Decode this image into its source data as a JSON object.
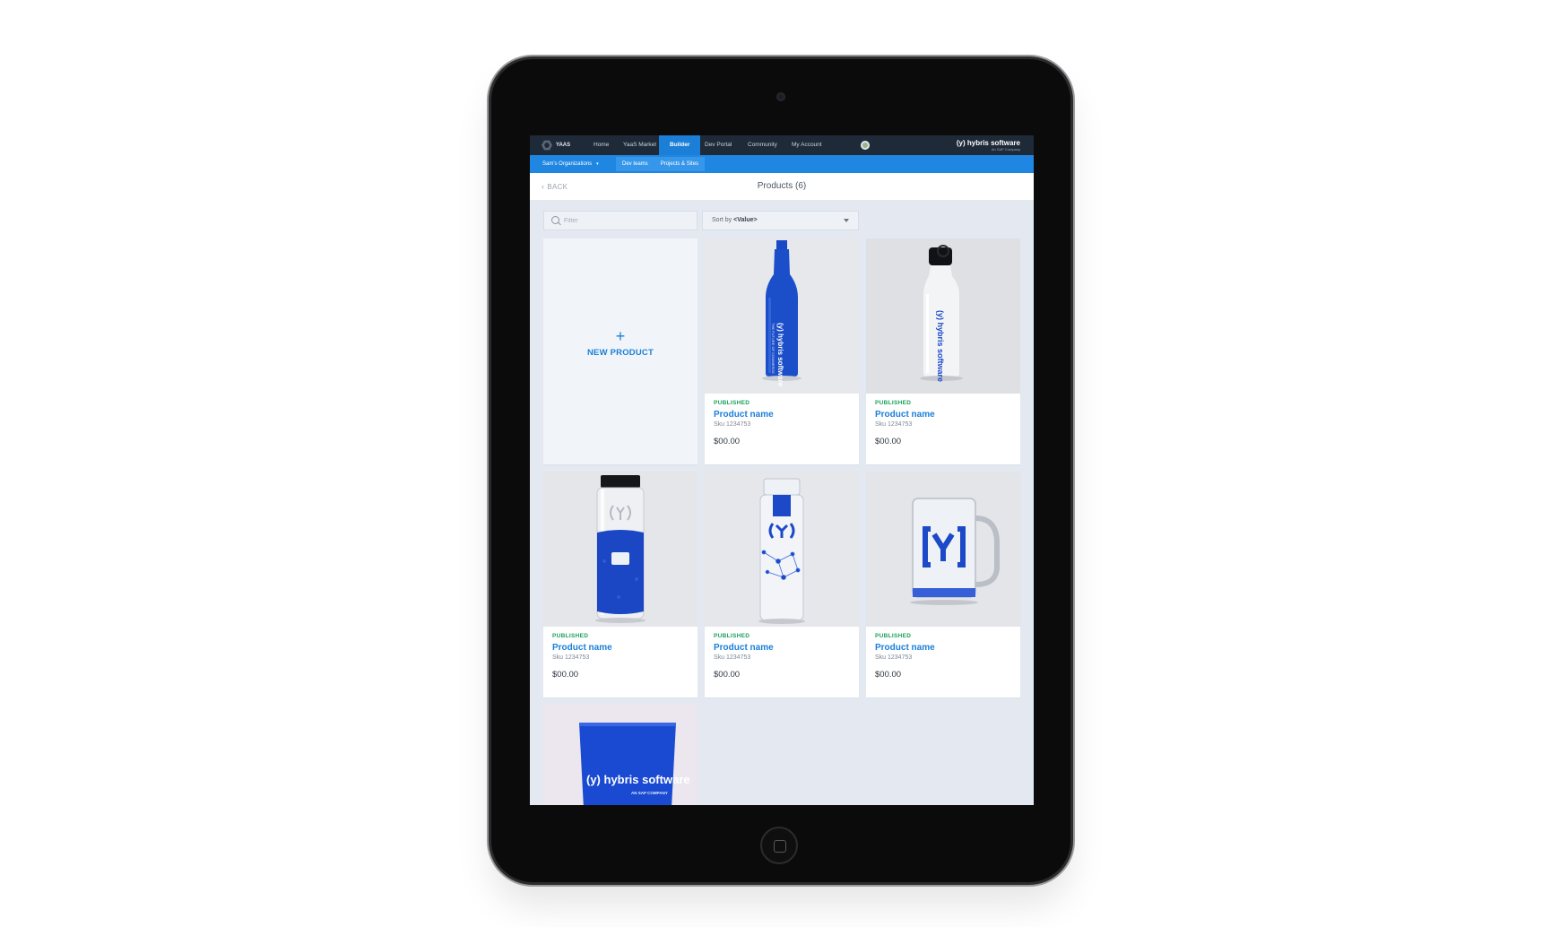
{
  "topnav": {
    "brand": "YAAS",
    "items": [
      {
        "label": "Home",
        "active": false
      },
      {
        "label": "YaaS Market",
        "active": false
      },
      {
        "label": "Builder",
        "active": true
      },
      {
        "label": "Dev Portal",
        "active": false
      },
      {
        "label": "Community",
        "active": false
      },
      {
        "label": "My Account",
        "active": false
      }
    ],
    "logo_main": "(y) hybris software",
    "logo_sub": "An SAP Company"
  },
  "subnav": {
    "organization": "Sam's Organizations",
    "tabs": [
      "Dev teams",
      "Projects & Sites"
    ]
  },
  "header": {
    "back_label": "BACK",
    "title": "Products (6)"
  },
  "toolbar": {
    "filter_placeholder": "Filter",
    "sort_prefix": "Sort by",
    "sort_value": "<Value>"
  },
  "new_product": {
    "plus": "+",
    "label": "NEW PRODUCT"
  },
  "products": [
    {
      "status": "PUBLISHED",
      "name": "Product name",
      "sku": "Sku 1234753",
      "price": "$00.00",
      "image": "blue-steel-bottle"
    },
    {
      "status": "PUBLISHED",
      "name": "Product name",
      "sku": "Sku 1234753",
      "price": "$00.00",
      "image": "white-steel-bottle"
    },
    {
      "status": "PUBLISHED",
      "name": "Product name",
      "sku": "Sku 1234753",
      "price": "$00.00",
      "image": "glass-bottle-blue-sleeve"
    },
    {
      "status": "PUBLISHED",
      "name": "Product name",
      "sku": "Sku 1234753",
      "price": "$00.00",
      "image": "clear-infuser-bottle"
    },
    {
      "status": "PUBLISHED",
      "name": "Product name",
      "sku": "Sku 1234753",
      "price": "$00.00",
      "image": "glass-mug"
    }
  ],
  "partial_card": {
    "image": "blue-cup",
    "cup_text": "(y) hybris software",
    "cup_subtext": "AN SAP COMPANY"
  },
  "bottle_text": {
    "main": "(y) hybris software",
    "sub": "THE FUTURE OF COMMERCE"
  },
  "colors": {
    "accent": "#1b7fd8",
    "nav_bg": "#1e2a38",
    "subnav_bg": "#1f86e2",
    "published": "#18a25a",
    "screen_bg": "#e4e9f1",
    "product_blue": "#1a49c8"
  },
  "icons": {
    "back": "chevron-left-icon",
    "search": "search-icon",
    "sort": "caret-down-icon",
    "new": "plus-icon",
    "brand": "hexagon-logo-icon"
  }
}
